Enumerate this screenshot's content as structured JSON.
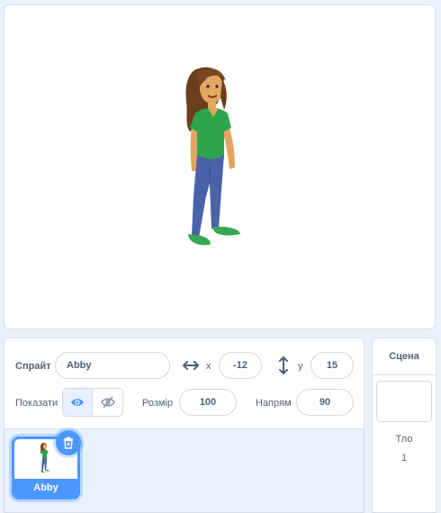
{
  "sprite_info": {
    "sprite_label": "Спрайт",
    "sprite_name": "Abby",
    "x_label": "x",
    "x_value": "-12",
    "y_label": "y",
    "y_value": "15",
    "show_label": "Показати",
    "size_label": "Розмір",
    "size_value": "100",
    "direction_label": "Напрям",
    "direction_value": "90"
  },
  "sprites": [
    {
      "name": "Abby",
      "selected": true
    }
  ],
  "stage_panel": {
    "title": "Сцена",
    "backdrops_label": "Тло",
    "backdrops_count": "1"
  },
  "colors": {
    "accent": "#4c97ff",
    "panel_bg": "#e9f1fc",
    "text": "#575e75"
  }
}
